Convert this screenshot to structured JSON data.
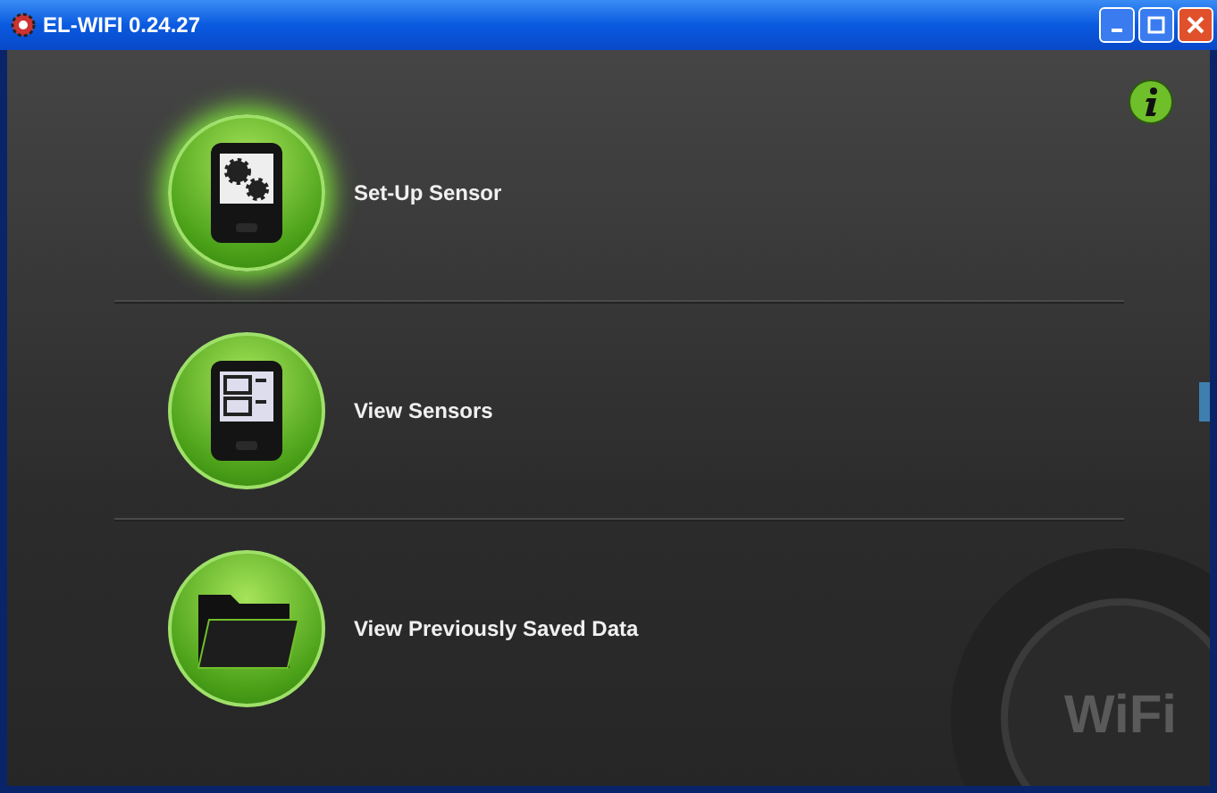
{
  "window": {
    "title": "EL-WIFI 0.24.27"
  },
  "menu": [
    {
      "label": "Set-Up Sensor",
      "kind": "setup",
      "selected": true
    },
    {
      "label": "View Sensors",
      "kind": "sensors",
      "selected": false
    },
    {
      "label": "View Previously Saved Data",
      "kind": "folder",
      "selected": false
    }
  ],
  "background_logo": "WiFi"
}
